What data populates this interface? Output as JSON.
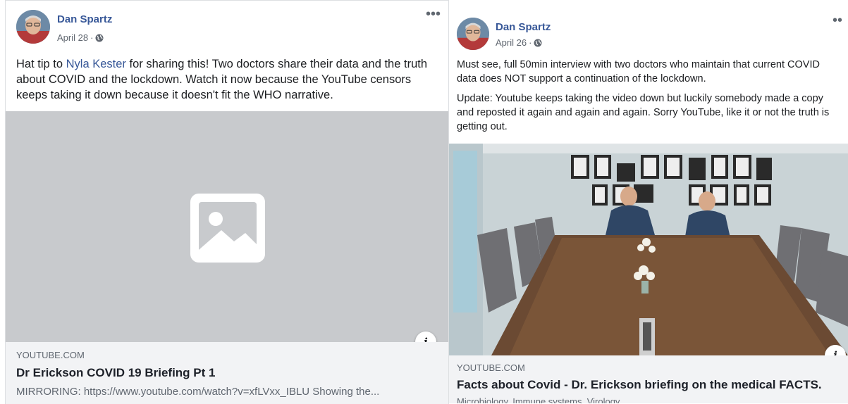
{
  "post1": {
    "author": "Dan Spartz",
    "date": "April 28",
    "separator": "·",
    "more_icon": "more-horizontal-icon",
    "text_before_link": "Hat tip to ",
    "mention": "Nyla Kester",
    "text_after_link": " for sharing this! Two doctors share their data and the truth about COVID and the lockdown. Watch it now because the YouTube censors keeps taking it down because it doesn't fit the WHO narrative.",
    "image_placeholder_icon": "image-placeholder-icon",
    "info_label": "i",
    "link": {
      "domain": "YOUTUBE.COM",
      "title": "Dr Erickson COVID 19 Briefing Pt 1",
      "description": "MIRRORING: https://www.youtube.com/watch?v=xfLVxx_IBLU Showing the..."
    }
  },
  "post2": {
    "author": "Dan Spartz",
    "date": "April 26",
    "separator": "·",
    "more_icon": "more-horizontal-icon",
    "paragraph1": "Must see, full 50min interview with two doctors who maintain that current COVID data does NOT support a continuation of the lockdown.",
    "paragraph2": "Update: Youtube keeps taking the video down but luckily somebody made a copy and reposted it again and again and again. Sorry YouTube, like it or not the truth is getting out.",
    "info_label": "i",
    "link": {
      "domain": "YOUTUBE.COM",
      "title": "Facts about Covid - Dr. Erickson briefing on the medical FACTS.",
      "description": "Microbiology, Immune systems, Virology..."
    }
  },
  "colors": {
    "link_blue": "#385898",
    "placeholder_bg": "#c8cacd",
    "linkbox_bg": "#f2f3f5"
  }
}
